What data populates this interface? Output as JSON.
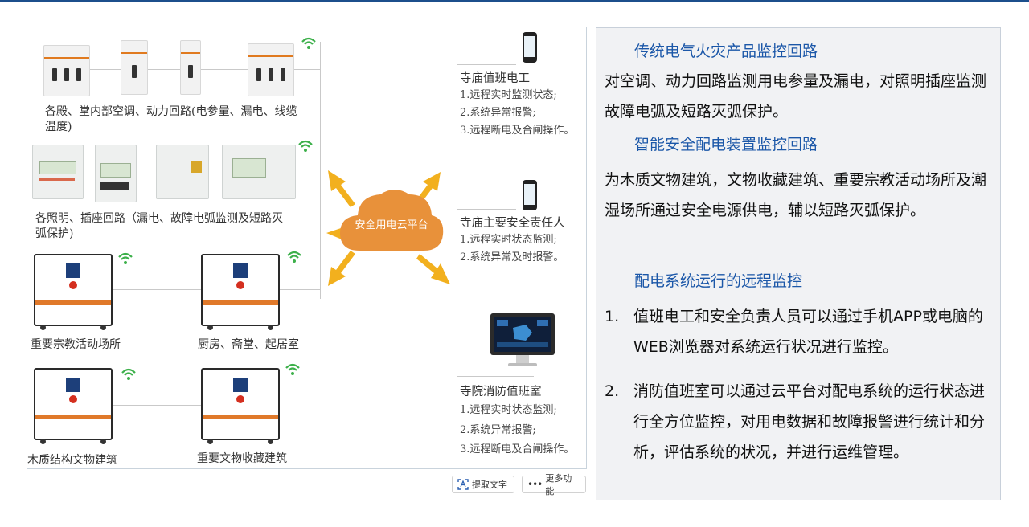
{
  "diagram": {
    "groups": [
      {
        "label": "各殿、堂内部空调、动力回路(电参量、漏电、线缆温度)"
      },
      {
        "label": "各照明、插座回路（漏电、故障电弧监测及短路灭弧保护)"
      },
      {
        "label": "重要宗教活动场所"
      },
      {
        "label": "厨房、斋堂、起居室"
      },
      {
        "label": "木质结构文物建筑"
      },
      {
        "label": "重要文物收藏建筑"
      }
    ],
    "cloud_label": "安全用电云平台",
    "endpoints": [
      {
        "role": "寺庙值班电工",
        "functions": [
          "1.远程实时监测状态;",
          "2.系统异常报警;",
          "3.远程断电及合闸操作。"
        ]
      },
      {
        "role": "寺庙主要安全责任人",
        "functions": [
          "1.远程实时状态监测;",
          "2.系统异常及时报警。"
        ]
      },
      {
        "role": "寺院消防值班室",
        "functions": [
          "1.远程实时状态监测;",
          "2.系统异常报警;",
          "3.远程断电及合闸操作。"
        ]
      }
    ]
  },
  "toolbar": {
    "extract_text": "提取文字",
    "more_features": "更多功能"
  },
  "panel": {
    "section1_title": "传统电气火灾产品监控回路",
    "section1_text": "对空调、动力回路监测用电参量及漏电，对照明插座监测故障电弧及短路灭弧保护。",
    "section2_title": "智能安全配电装置监控回路",
    "section2_text": "为木质文物建筑，文物收藏建筑、重要宗教活动场所及潮湿场所通过安全电源供电，辅以短路灭弧保护。",
    "section3_title": "配电系统运行的远程监控",
    "items": [
      {
        "num": "1.",
        "text": "值班电工和安全负责人员可以通过手机APP或电脑的WEB浏览器对系统运行状况进行监控。"
      },
      {
        "num": "2.",
        "text": "消防值班室可以通过云平台对配电系统的运行状态进行全方位监控，对用电数据和故障报警进行统计和分析，评估系统的状况，并进行运维管理。"
      }
    ]
  },
  "colors": {
    "accent_blue": "#1b57a8",
    "cloud_orange": "#e8913a",
    "arrow_yellow": "#f2b01e",
    "wifi_green": "#3cb04a"
  }
}
